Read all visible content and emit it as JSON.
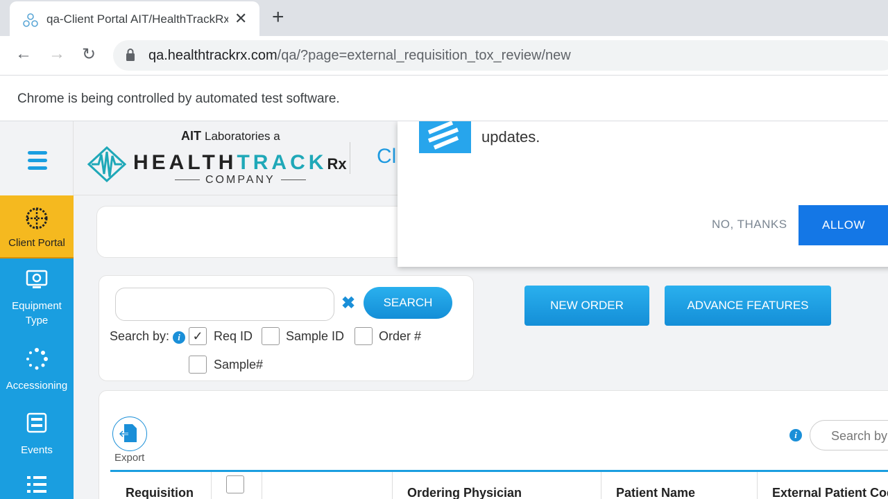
{
  "browser": {
    "tab_title": "qa-Client Portal AIT/HealthTrackRx",
    "url_host": "qa.healthtrackrx.com",
    "url_path": "/qa/?page=external_requisition_tox_review/new",
    "infobar_text": "Chrome is being controlled by automated test software."
  },
  "header": {
    "logo_ait": "AIT",
    "logo_laboratories": "Laboratories a",
    "logo_health": "HEALTH",
    "logo_track": "TRACK",
    "logo_rx": "Rx",
    "logo_company": "COMPANY",
    "title_partial": "Cli"
  },
  "sidebar": {
    "items": [
      {
        "label": "Client Portal"
      },
      {
        "label": "Equipment Type"
      },
      {
        "label": "Accessioning"
      },
      {
        "label": "Events"
      }
    ]
  },
  "notification": {
    "message": "updates.",
    "no_label": "NO, THANKS",
    "allow_label": "ALLOW"
  },
  "search": {
    "placeholder": "",
    "button_label": "SEARCH",
    "search_by_label": "Search by:",
    "options": [
      {
        "label": "Req ID",
        "checked": true
      },
      {
        "label": "Sample ID",
        "checked": false
      },
      {
        "label": "Order #",
        "checked": false
      },
      {
        "label": "Sample#",
        "checked": false
      }
    ]
  },
  "actions": {
    "new_order": "NEW ORDER",
    "advance_features": "ADVANCE FEATURES"
  },
  "table": {
    "export_label": "Export",
    "search_placeholder": "Search by",
    "columns": [
      "Requisition",
      "",
      "",
      "Ordering Physician",
      "Patient Name",
      "External Patient Code"
    ]
  },
  "colors": {
    "accent": "#1a9ee0",
    "active_nav": "#f5b91f",
    "allow_button": "#1477e6"
  }
}
